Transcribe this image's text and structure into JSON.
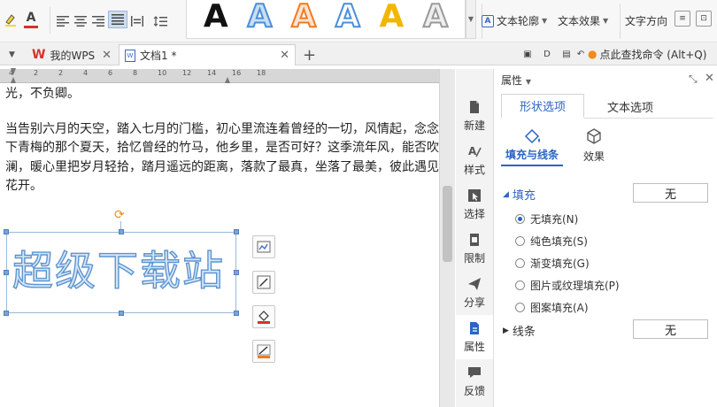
{
  "gallery": {
    "letter": "A",
    "colors": [
      "#111111",
      "#4a8ed8",
      "#ee7b25",
      "#4a8ed8",
      "#f2b600",
      "#9a9a9a"
    ]
  },
  "ribbon": {
    "text_outline": "文本轮廓",
    "text_effect": "文本效果",
    "text_direction": "文字方向"
  },
  "tabs": {
    "wps": "我的WPS",
    "doc": "文档1 *",
    "search_hint": "点此查找命令 (Alt+Q)"
  },
  "ruler": {
    "ticks": [
      "4",
      "2",
      "2",
      "4",
      "6",
      "8",
      "10",
      "12",
      "14",
      "16",
      "18"
    ]
  },
  "document": {
    "line1": "光，不负卿。",
    "line2": "当告别六月的天空，踏入七月的门槛，初心里流连着曾经的一切，风情起，念念有",
    "line3": "下青梅的那个夏天，拾忆曾经的竹马，他乡里，是否可好？这季流年风，能否吹拢",
    "line4": "澜，暖心里把岁月轻拾，踏月遥远的距离，落款了最真，坐落了最美，彼此遇见彩",
    "line5": "花开。",
    "wordart": "超级下载站"
  },
  "sidebar": {
    "new": "新建",
    "style": "样式",
    "select": "选择",
    "restrict": "限制",
    "share": "分享",
    "properties": "属性",
    "feedback": "反馈"
  },
  "panel": {
    "title": "属性",
    "tab_shape": "形状选项",
    "tab_text": "文本选项",
    "sub_fill_line": "填充与线条",
    "sub_effect": "效果",
    "fill_title": "填充",
    "fill_value": "无",
    "line_title": "线条",
    "line_value": "无",
    "options": [
      "无填充(N)",
      "纯色填充(S)",
      "渐变填充(G)",
      "图片或纹理填充(P)",
      "图案填充(A)"
    ]
  },
  "colors": {
    "accent": "#2b64c4",
    "wps_red": "#d9302a",
    "rotate": "#f08c1b"
  }
}
